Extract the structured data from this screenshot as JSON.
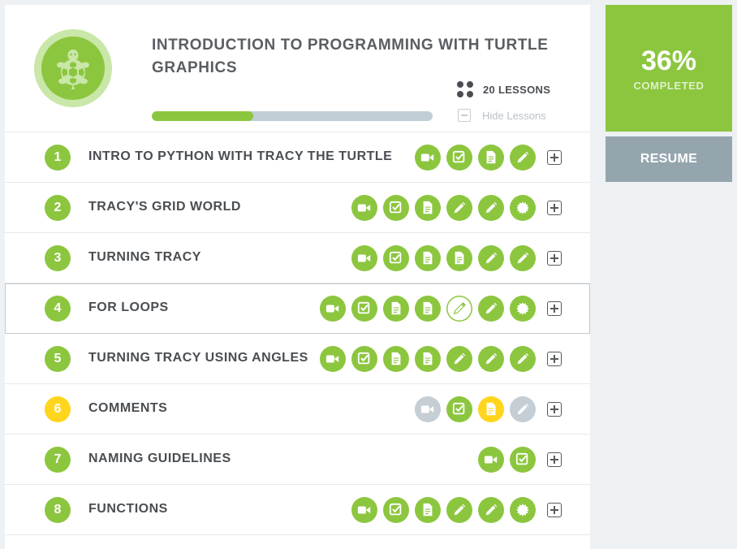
{
  "course": {
    "title": "INTRODUCTION TO PROGRAMMING WITH TURTLE GRAPHICS",
    "logo_icon": "turtle-icon",
    "lessons_count": "20 LESSONS",
    "hide_lessons_label": "Hide Lessons",
    "progress_fraction": 0.36
  },
  "sidebar": {
    "percent": "36%",
    "completed_label": "COMPLETED",
    "resume_label": "RESUME"
  },
  "colors": {
    "green": "#8cc63f",
    "gray": "#c4ced4",
    "yellow": "#ffd51d",
    "resume": "#95a5ae"
  },
  "lessons": [
    {
      "number": "1",
      "title": "INTRO TO PYTHON WITH TRACY THE TURTLE",
      "status": "green",
      "items": [
        {
          "type": "video",
          "state": "green"
        },
        {
          "type": "quiz",
          "state": "green"
        },
        {
          "type": "doc",
          "state": "green"
        },
        {
          "type": "exercise",
          "state": "green"
        }
      ]
    },
    {
      "number": "2",
      "title": "TRACY'S GRID WORLD",
      "status": "green",
      "items": [
        {
          "type": "video",
          "state": "green"
        },
        {
          "type": "quiz",
          "state": "green"
        },
        {
          "type": "doc",
          "state": "green"
        },
        {
          "type": "exercise",
          "state": "green"
        },
        {
          "type": "exercise",
          "state": "green"
        },
        {
          "type": "badge",
          "state": "green"
        }
      ]
    },
    {
      "number": "3",
      "title": "TURNING TRACY",
      "status": "green",
      "items": [
        {
          "type": "video",
          "state": "green"
        },
        {
          "type": "quiz",
          "state": "green"
        },
        {
          "type": "doc",
          "state": "green"
        },
        {
          "type": "doc",
          "state": "green"
        },
        {
          "type": "exercise",
          "state": "green"
        },
        {
          "type": "exercise",
          "state": "green"
        }
      ]
    },
    {
      "number": "4",
      "title": "FOR LOOPS",
      "status": "green",
      "active": true,
      "items": [
        {
          "type": "video",
          "state": "green"
        },
        {
          "type": "quiz",
          "state": "green"
        },
        {
          "type": "doc",
          "state": "green"
        },
        {
          "type": "doc",
          "state": "green"
        },
        {
          "type": "exercise",
          "state": "outline"
        },
        {
          "type": "exercise",
          "state": "green"
        },
        {
          "type": "badge",
          "state": "green"
        }
      ]
    },
    {
      "number": "5",
      "title": "TURNING TRACY USING ANGLES",
      "status": "green",
      "items": [
        {
          "type": "video",
          "state": "green"
        },
        {
          "type": "quiz",
          "state": "green"
        },
        {
          "type": "doc",
          "state": "green"
        },
        {
          "type": "doc",
          "state": "green"
        },
        {
          "type": "exercise",
          "state": "green"
        },
        {
          "type": "exercise",
          "state": "green"
        },
        {
          "type": "exercise",
          "state": "green"
        }
      ]
    },
    {
      "number": "6",
      "title": "COMMENTS",
      "status": "yellow",
      "items": [
        {
          "type": "video",
          "state": "gray"
        },
        {
          "type": "quiz",
          "state": "green"
        },
        {
          "type": "doc",
          "state": "yellow"
        },
        {
          "type": "exercise",
          "state": "gray"
        }
      ]
    },
    {
      "number": "7",
      "title": "NAMING GUIDELINES",
      "status": "green",
      "items": [
        {
          "type": "video",
          "state": "green"
        },
        {
          "type": "quiz",
          "state": "green"
        }
      ]
    },
    {
      "number": "8",
      "title": "FUNCTIONS",
      "status": "green",
      "items": [
        {
          "type": "video",
          "state": "green"
        },
        {
          "type": "quiz",
          "state": "green"
        },
        {
          "type": "doc",
          "state": "green"
        },
        {
          "type": "exercise",
          "state": "green"
        },
        {
          "type": "exercise",
          "state": "green"
        },
        {
          "type": "badge",
          "state": "green"
        }
      ]
    }
  ]
}
